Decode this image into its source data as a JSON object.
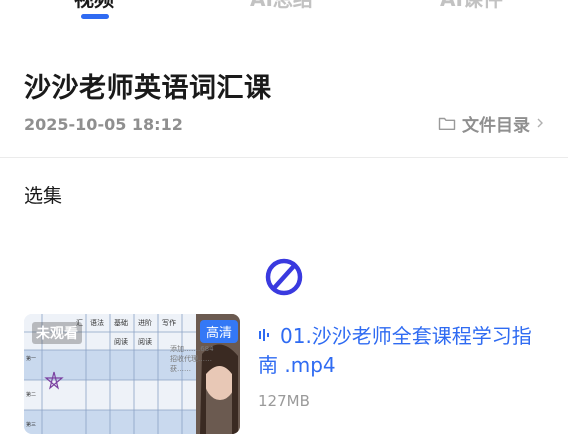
{
  "tabs": [
    {
      "label": "视频",
      "active": true
    },
    {
      "label": "AI总结",
      "active": false
    },
    {
      "label": "AI课件",
      "active": false
    }
  ],
  "course": {
    "title": "沙沙老师英语词汇课",
    "date": "2025-10-05  18:12",
    "directory_label": "文件目录"
  },
  "section": {
    "title": "选集"
  },
  "episode": {
    "badge": "未观看",
    "quality": "高清",
    "title": "01.沙沙老师全套课程学习指南 .mp4",
    "size": "127MB",
    "thumbnail_headers": [
      "汇",
      "语法",
      "基础",
      "进阶",
      "写作"
    ],
    "thumbnail_subheaders": [
      "阅读",
      "阅读"
    ],
    "thumbnail_rows": [
      "第一",
      "第二",
      "第三"
    ],
    "watermark": [
      "添加…….684",
      "招收代理……",
      "获……"
    ]
  },
  "colors": {
    "accent": "#2f6bf2",
    "forbidden_icon": "#3a3adf",
    "badge": "#3478f6"
  },
  "icons": {
    "directory": "folder-icon",
    "chevron": "chevron-right-icon",
    "status": "no-entry-icon",
    "audio": "audio-wave-icon"
  }
}
